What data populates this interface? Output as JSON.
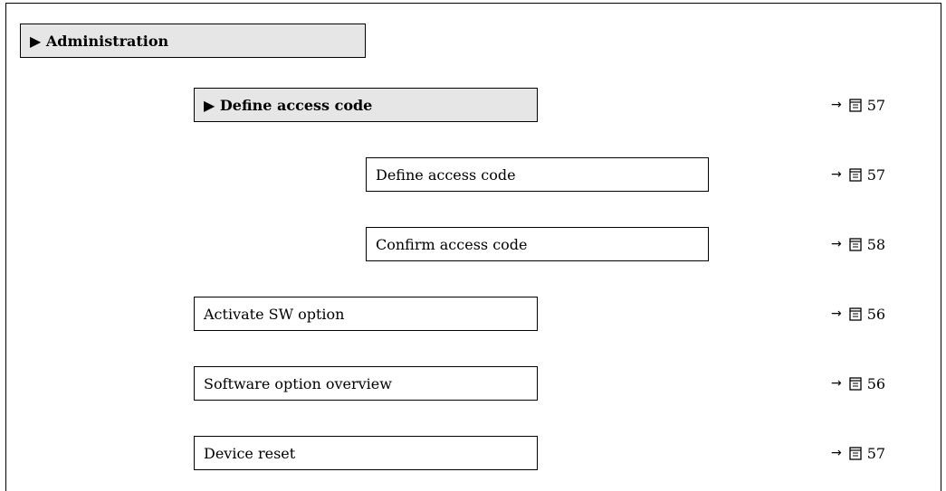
{
  "administration": {
    "label": "Administration",
    "marker": "▶"
  },
  "define_access_code_menu": {
    "label": "Define access code",
    "marker": "▶",
    "page": "57"
  },
  "items": [
    {
      "label": "Define access code",
      "page": "57"
    },
    {
      "label": "Confirm access code",
      "page": "58"
    },
    {
      "label": "Activate SW option",
      "page": "56"
    },
    {
      "label": "Software option overview",
      "page": "56"
    },
    {
      "label": "Device reset",
      "page": "57"
    }
  ],
  "ref_arrow": "→",
  "icons": {
    "page_reference": "book-icon"
  }
}
